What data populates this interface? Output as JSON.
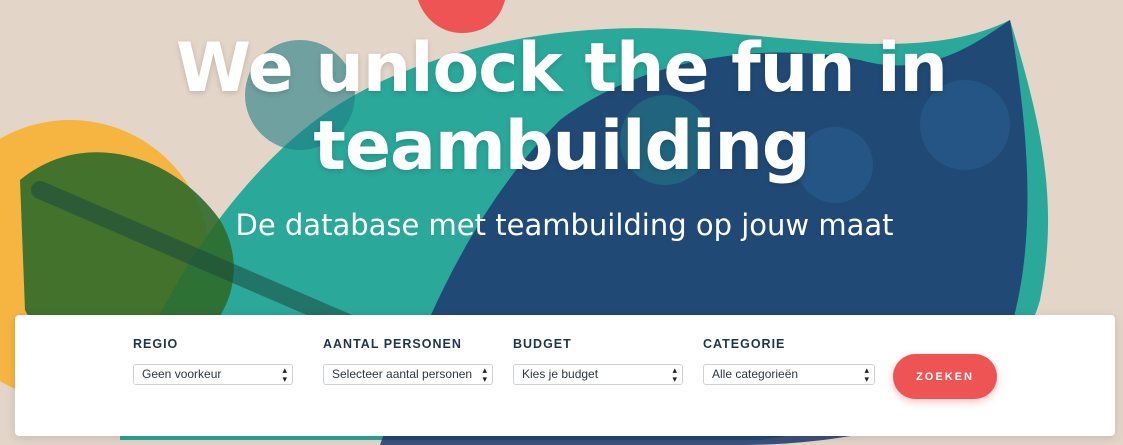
{
  "hero": {
    "headline_line1": "We unlock the fun in",
    "headline_line2": "teambuilding",
    "subheadline": "De database met teambuilding op jouw maat"
  },
  "search": {
    "fields": [
      {
        "label": "REGIO",
        "value": "Geen voorkeur"
      },
      {
        "label": "AANTAL PERSONEN",
        "value": "Selecteer aantal personen"
      },
      {
        "label": "BUDGET",
        "value": "Kies je budget"
      },
      {
        "label": "CATEGORIE",
        "value": "Alle categorieën"
      }
    ],
    "button_label": "ZOEKEN"
  },
  "colors": {
    "background": "#e3d5c8",
    "teal": "#2aa89a",
    "navy": "#1e3a6e",
    "orange": "#f6b440",
    "coral": "#ef5454",
    "label_navy": "#1f3450"
  }
}
